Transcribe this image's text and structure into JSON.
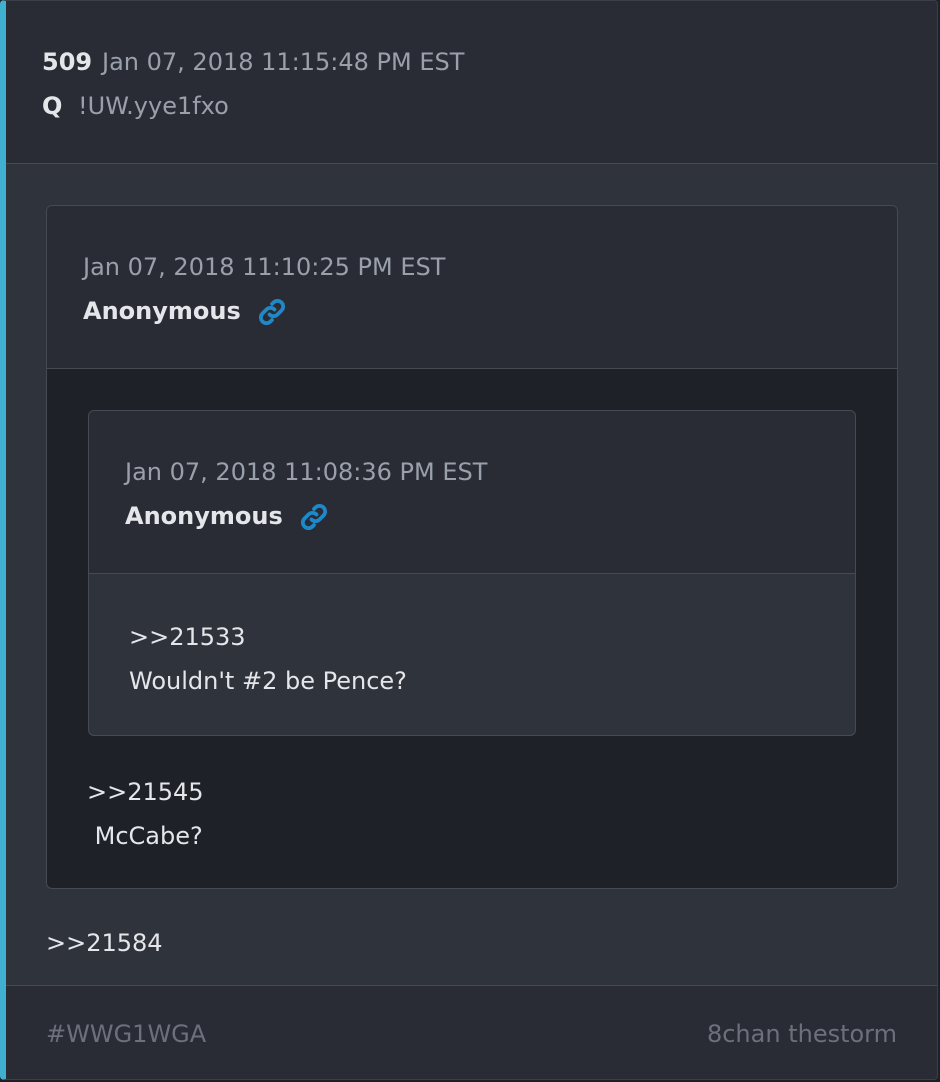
{
  "post": {
    "number": "509",
    "date": "Jan 07, 2018 11:15:48 PM EST",
    "author": "Q",
    "tripcode": "!UW.yye1fxo",
    "reply_text": ">>21584"
  },
  "quoted_post": {
    "date": "Jan 07, 2018 11:10:25 PM EST",
    "author": "Anonymous",
    "link_icon": "link-icon",
    "reply_ref": ">>21545",
    "text": " McCabe?"
  },
  "nested_quoted_post": {
    "date": "Jan 07, 2018 11:08:36 PM EST",
    "author": "Anonymous",
    "link_icon": "link-icon",
    "reply_ref": ">>21533",
    "text": "Wouldn't #2 be Pence?"
  },
  "footer": {
    "tag": "#WWG1WGA",
    "source": "8chan thestorm"
  },
  "colors": {
    "accent": "#3fb0d0",
    "link": "#1e88c8",
    "background": "#2f333c",
    "header": "#292c34"
  }
}
